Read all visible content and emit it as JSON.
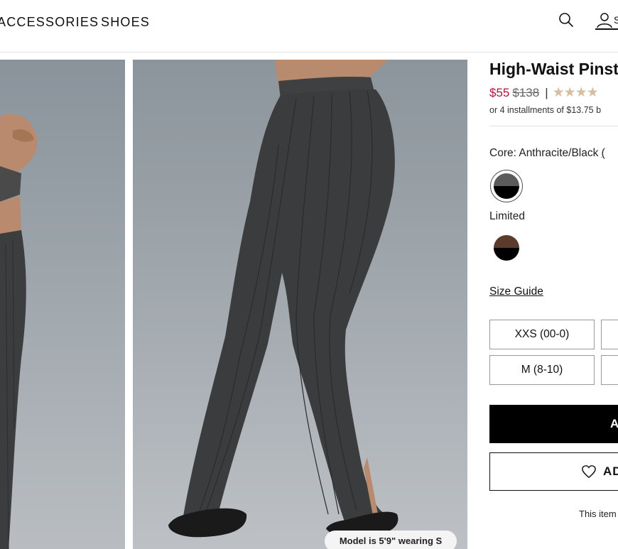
{
  "header": {
    "nav": [
      {
        "label": "ACCESSORIES"
      },
      {
        "label": "SHOES"
      }
    ],
    "search_icon": "search-icon",
    "account_icon": "user-icon",
    "account_label": "S"
  },
  "gallery": {
    "model_note": "Model is 5'9\" wearing S"
  },
  "product": {
    "title": "High-Waist Pinst",
    "sale_price": "$55",
    "original_price": "$138",
    "separator": "|",
    "rating_stars": "★★★★",
    "installments": "or 4 installments of $13.75 b",
    "color_label": "Core: Anthracite/Black",
    "color_link": "(",
    "swatches_core": [
      {
        "name": "Anthracite/Black",
        "top": "#5b5b5b",
        "bottom": "#000000"
      }
    ],
    "limited_label": "Limited",
    "swatches_limited": [
      {
        "name": "Espresso/Black",
        "top": "#5b3b2c",
        "bottom": "#000000"
      }
    ],
    "size_guide": "Size Guide",
    "sizes": [
      {
        "label": "XXS (00-0)"
      },
      {
        "label": "M (8-10)"
      },
      {
        "label": ""
      },
      {
        "label": ""
      }
    ],
    "add_to_bag": "A",
    "wishlist": "AD",
    "note": "This item"
  },
  "colors": {
    "sale": "#b3123c",
    "star": "#d6bfa0",
    "button_dark": "#000000"
  }
}
